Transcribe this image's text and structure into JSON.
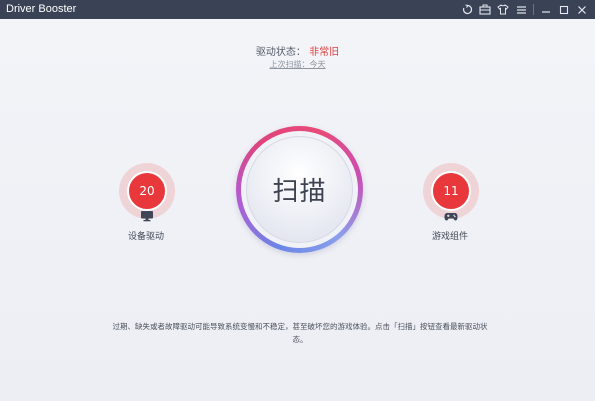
{
  "window": {
    "title": "Driver Booster",
    "icons": [
      "refresh-icon",
      "toolbox-icon",
      "shirt-icon",
      "menu-icon",
      "minimize-icon",
      "maximize-icon",
      "close-icon"
    ]
  },
  "status": {
    "label": "驱动状态：",
    "value": "非常旧",
    "last_scan": "上次扫描：今天",
    "value_color": "#e2403f"
  },
  "scan_button": {
    "label": "扫描"
  },
  "device_drivers": {
    "count": "20",
    "label": "设备驱动",
    "icon": "monitor-icon"
  },
  "game_components": {
    "count": "11",
    "label": "游戏组件",
    "icon": "gamepad-icon"
  },
  "footer": {
    "message": "过期、缺失或者故障驱动可能导致系统变慢和不稳定，甚至破坏您的游戏体验。点击「扫描」按钮查看最新驱动状态。"
  }
}
